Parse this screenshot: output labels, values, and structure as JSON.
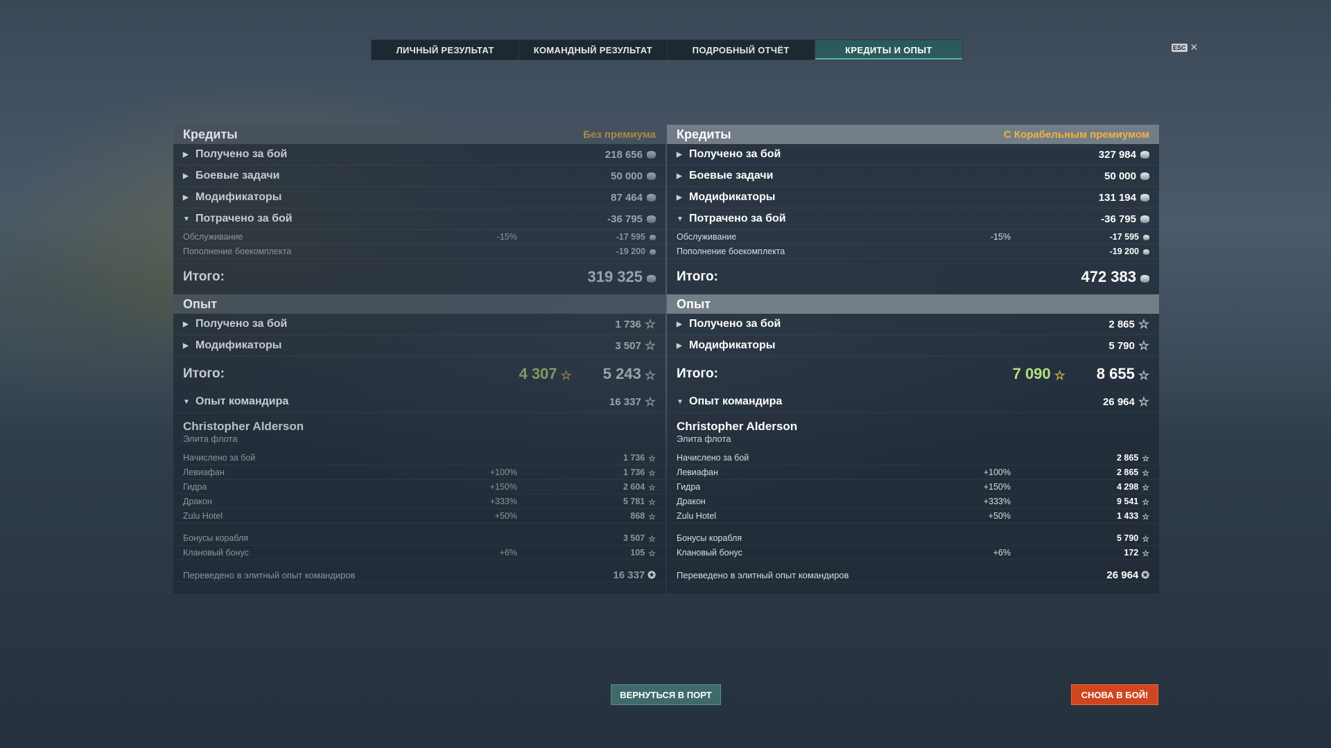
{
  "tabs": [
    "ЛИЧНЫЙ РЕЗУЛЬТАТ",
    "КОМАНДНЫЙ РЕЗУЛЬТАТ",
    "ПОДРОБНЫЙ ОТЧЁТ",
    "КРЕДИТЫ И ОПЫТ"
  ],
  "active_tab": 3,
  "esc": {
    "key": "ESC",
    "close": "✕"
  },
  "left": {
    "credits_title": "Кредиты",
    "premium_label": "Без премиума",
    "credit_rows": [
      {
        "label": "Получено за бой",
        "value": "218 656"
      },
      {
        "label": "Боевые задачи",
        "value": "50 000"
      },
      {
        "label": "Модификаторы",
        "value": "87 464"
      },
      {
        "label": "Потрачено за бой",
        "value": "-36 795"
      }
    ],
    "spent_sub": [
      {
        "label": "Обслуживание",
        "pct": "-15%",
        "value": "-17 595"
      },
      {
        "label": "Пополнение боекомплекта",
        "pct": "",
        "value": "-19 200"
      }
    ],
    "credits_total_label": "Итого:",
    "credits_total": "319 325",
    "xp_title": "Опыт",
    "xp_rows": [
      {
        "label": "Получено за бой",
        "value": "1 736"
      },
      {
        "label": "Модификаторы",
        "value": "3 507"
      }
    ],
    "xp_total_label": "Итого:",
    "xp_total_green": "4 307",
    "xp_total": "5 243",
    "cmd_xp_label": "Опыт командира",
    "cmd_xp_value": "16 337",
    "commander_name": "Christopher Alderson",
    "commander_rank": "Элита флота",
    "cmd_rows": [
      {
        "label": "Начислено за бой",
        "pct": "",
        "value": "1 736"
      },
      {
        "label": "Левиафан",
        "pct": "+100%",
        "value": "1 736"
      },
      {
        "label": "Гидра",
        "pct": "+150%",
        "value": "2 604"
      },
      {
        "label": "Дракон",
        "pct": "+333%",
        "value": "5 781"
      },
      {
        "label": "Zulu Hotel",
        "pct": "+50%",
        "value": "868"
      }
    ],
    "bonus_rows": [
      {
        "label": "Бонусы корабля",
        "pct": "",
        "value": "3 507"
      },
      {
        "label": "Клановый бонус",
        "pct": "+6%",
        "value": "105"
      }
    ],
    "elite_label": "Переведено в элитный опыт командиров",
    "elite_value": "16 337"
  },
  "right": {
    "credits_title": "Кредиты",
    "premium_label": "С Корабельным премиумом",
    "credit_rows": [
      {
        "label": "Получено за бой",
        "value": "327 984"
      },
      {
        "label": "Боевые задачи",
        "value": "50 000"
      },
      {
        "label": "Модификаторы",
        "value": "131 194"
      },
      {
        "label": "Потрачено за бой",
        "value": "-36 795"
      }
    ],
    "spent_sub": [
      {
        "label": "Обслуживание",
        "pct": "-15%",
        "value": "-17 595"
      },
      {
        "label": "Пополнение боекомплекта",
        "pct": "",
        "value": "-19 200"
      }
    ],
    "credits_total_label": "Итого:",
    "credits_total": "472 383",
    "xp_title": "Опыт",
    "xp_rows": [
      {
        "label": "Получено за бой",
        "value": "2 865"
      },
      {
        "label": "Модификаторы",
        "value": "5 790"
      }
    ],
    "xp_total_label": "Итого:",
    "xp_total_green": "7 090",
    "xp_total": "8 655",
    "cmd_xp_label": "Опыт командира",
    "cmd_xp_value": "26 964",
    "commander_name": "Christopher Alderson",
    "commander_rank": "Элита флота",
    "cmd_rows": [
      {
        "label": "Начислено за бой",
        "pct": "",
        "value": "2 865"
      },
      {
        "label": "Левиафан",
        "pct": "+100%",
        "value": "2 865"
      },
      {
        "label": "Гидра",
        "pct": "+150%",
        "value": "4 298"
      },
      {
        "label": "Дракон",
        "pct": "+333%",
        "value": "9 541"
      },
      {
        "label": "Zulu Hotel",
        "pct": "+50%",
        "value": "1 433"
      }
    ],
    "bonus_rows": [
      {
        "label": "Бонусы корабля",
        "pct": "",
        "value": "5 790"
      },
      {
        "label": "Клановый бонус",
        "pct": "+6%",
        "value": "172"
      }
    ],
    "elite_label": "Переведено в элитный опыт командиров",
    "elite_value": "26 964"
  },
  "buttons": {
    "port": "ВЕРНУТЬСЯ В ПОРТ",
    "battle": "СНОВА В БОЙ!"
  },
  "colors": {
    "active_tab": "#2b5a5c",
    "premium_gold": "#f0b33e",
    "battle_button": "#d0461e",
    "port_button": "#3f6a6b",
    "green_xp": "#b4e07f"
  }
}
